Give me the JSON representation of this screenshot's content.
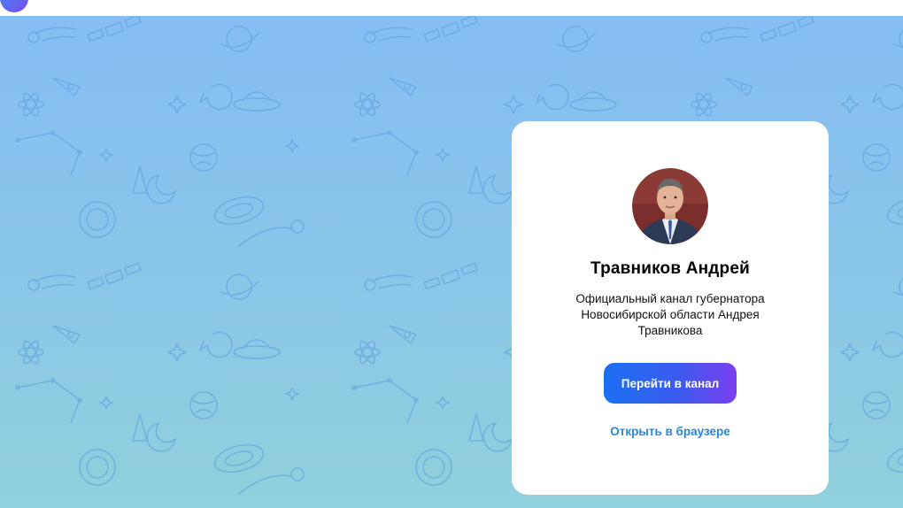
{
  "header": {
    "logo_icon": "telegram-logo-icon"
  },
  "background": {
    "pattern": "space-doodle-pattern",
    "colors": {
      "top": "#86bdf3",
      "bottom": "#91d0dc",
      "doodle": "#5a9fe0"
    }
  },
  "channel": {
    "avatar_icon": "channel-avatar-photo",
    "name": "Травников Андрей",
    "description": "Официальный канал губернатора Новосибирской области Андрея Травникова",
    "join_button_label": "Перейти в канал",
    "open_in_browser_label": "Открыть в браузере"
  },
  "colors": {
    "button_gradient_start": "#1b6ff2",
    "button_gradient_end": "#7b3ff0",
    "link": "#2a86dc"
  }
}
